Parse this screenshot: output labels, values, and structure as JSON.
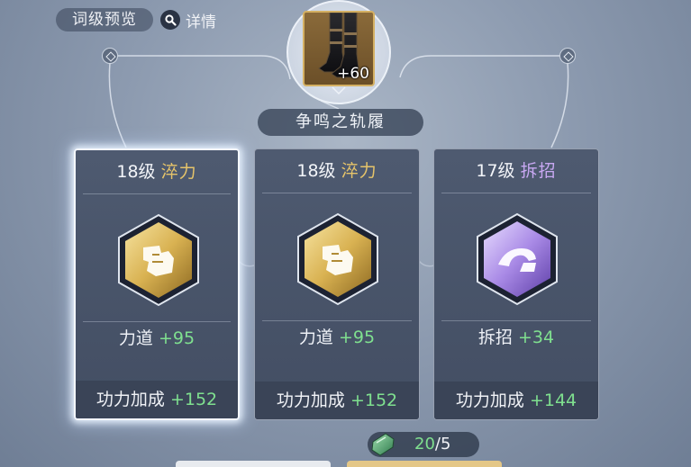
{
  "header": {
    "preview_label": "词级预览",
    "detail_label": "详情"
  },
  "item": {
    "level_text": "+60",
    "name": "争鸣之轨履"
  },
  "cards": [
    {
      "level": "18级",
      "tag": "淬力",
      "tag_color": "#e6c46a",
      "stat_name": "力道",
      "stat_value": "+95",
      "bonus_name": "功力加成",
      "bonus_value": "+152",
      "emblem": "gold-fist-icon",
      "selected": true
    },
    {
      "level": "18级",
      "tag": "淬力",
      "tag_color": "#e6c46a",
      "stat_name": "力道",
      "stat_value": "+95",
      "bonus_name": "功力加成",
      "bonus_value": "+152",
      "emblem": "gold-fist-icon",
      "selected": false
    },
    {
      "level": "17级",
      "tag": "拆招",
      "tag_color": "#c8a8f2",
      "stat_name": "拆招",
      "stat_value": "+34",
      "bonus_name": "功力加成",
      "bonus_value": "+144",
      "emblem": "purple-arm-icon",
      "selected": false
    }
  ],
  "cost": {
    "have": "20",
    "need": "/5",
    "icon": "jade-stone-icon"
  },
  "colors": {
    "gold": "#e6c46a",
    "purple": "#c8a8f2",
    "green_value": "#7fe08f"
  }
}
